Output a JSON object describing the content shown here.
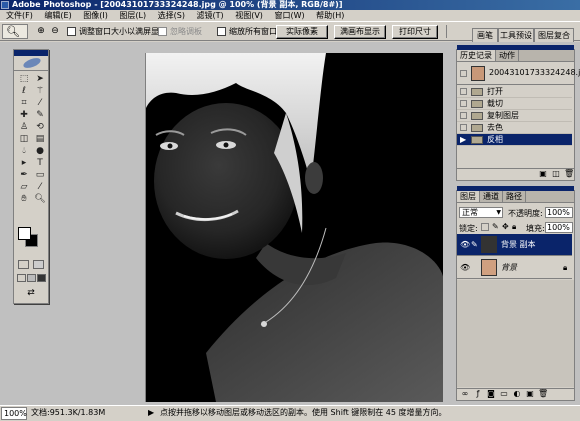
{
  "titlebar": {
    "title": "Adobe Photoshop - [20043101733324248.jpg @ 100% (背景 副本, RGB/8#)]"
  },
  "menu": [
    "文件(F)",
    "编辑(E)",
    "图像(I)",
    "图层(L)",
    "选择(S)",
    "滤镜(T)",
    "视图(V)",
    "窗口(W)",
    "帮助(H)"
  ],
  "options": {
    "tool_icon": "zoom-icon",
    "resize_windows_label": "调整窗口大小以满屏显示",
    "ignore_palettes_label": "忽略调板",
    "zoom_all_label": "缩放所有窗口",
    "actual_pixels": "实际像素",
    "fit_screen": "满画布显示",
    "print_size": "打印尺寸"
  },
  "workspace_tabs": [
    "画笔",
    "工具预设",
    "图层复合"
  ],
  "history": {
    "tabs": [
      "历史记录",
      "动作"
    ],
    "snapshot": "20043101733324248.jpg",
    "items": [
      "打开",
      "载切",
      "复制图层",
      "去色",
      "反相"
    ],
    "selected_index": 4
  },
  "layers": {
    "tabs": [
      "图层",
      "通道",
      "路径"
    ],
    "blend_mode": "正常",
    "opacity_label": "不透明度:",
    "opacity_value": "100%",
    "lock_label": "锁定:",
    "fill_label": "填充:",
    "fill_value": "100%",
    "items": [
      {
        "name": "背景 副本",
        "selected": true
      },
      {
        "name": "背景",
        "selected": false
      }
    ]
  },
  "status": {
    "zoom": "100%",
    "doc_size": "文档:951.3K/1.83M",
    "hint": "点按并拖移以移动图层或移动选区的副本。使用 Shift 键限制在 45 度增量方向。"
  },
  "colors": {
    "title_bar": "#0a246a",
    "selection": "#0a246a",
    "chrome": "#d4d0c8"
  }
}
